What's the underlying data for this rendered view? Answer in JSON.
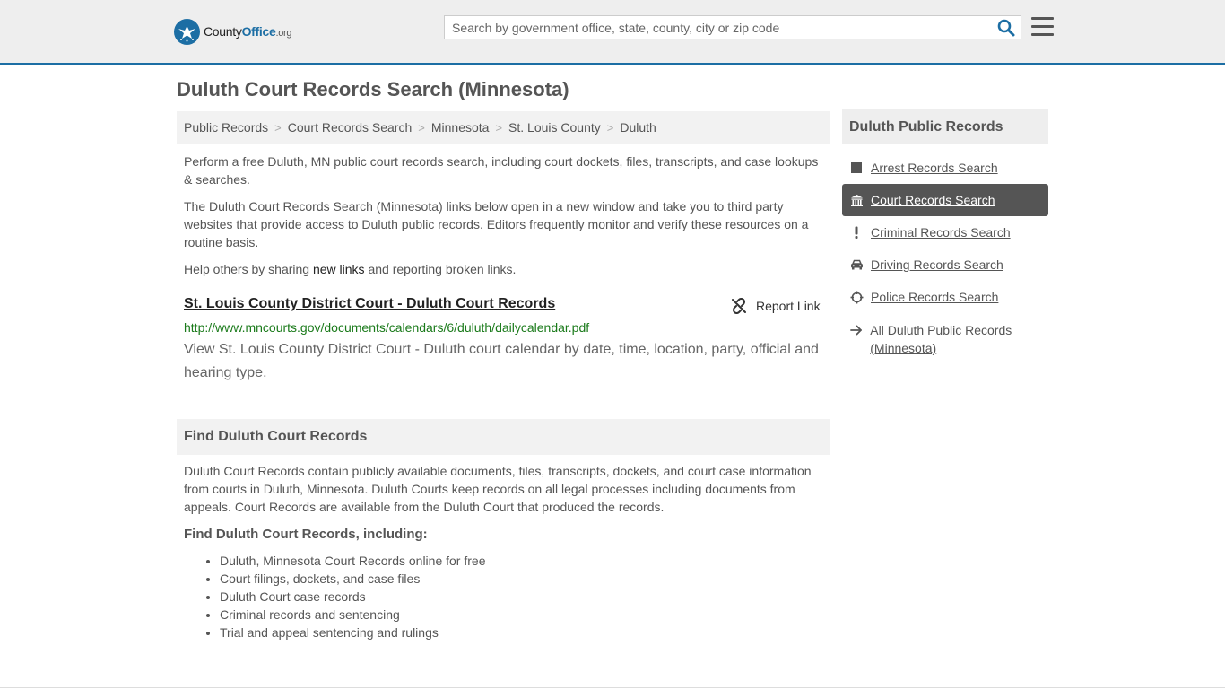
{
  "header": {
    "logo": {
      "brand_county": "County",
      "brand_office": "Office",
      "brand_org": ".org"
    },
    "search": {
      "placeholder": "Search by government office, state, county, city or zip code"
    }
  },
  "page": {
    "title": "Duluth Court Records Search (Minnesota)",
    "breadcrumb": [
      "Public Records",
      "Court Records Search",
      "Minnesota",
      "St. Louis County",
      "Duluth"
    ],
    "intro": {
      "p1": "Perform a free Duluth, MN public court records search, including court dockets, files, transcripts, and case lookups & searches.",
      "p2": "The Duluth Court Records Search (Minnesota) links below open in a new window and take you to third party websites that provide access to Duluth public records. Editors frequently monitor and verify these resources on a routine basis.",
      "p3_before": "Help others by sharing ",
      "p3_link": "new links",
      "p3_after": " and reporting broken links."
    },
    "result": {
      "title": "St. Louis County District Court - Duluth Court Records",
      "report_label": "Report Link",
      "url": "http://www.mncourts.gov/documents/calendars/6/duluth/dailycalendar.pdf",
      "description": "View St. Louis County District Court - Duluth court calendar by date, time, location, party, official and hearing type."
    },
    "find": {
      "heading": "Find Duluth Court Records",
      "text": "Duluth Court Records contain publicly available documents, files, transcripts, dockets, and court case information from courts in Duluth, Minnesota. Duluth Courts keep records on all legal processes including documents from appeals. Court Records are available from the Duluth Court that produced the records.",
      "subheading": "Find Duluth Court Records, including:",
      "items": [
        "Duluth, Minnesota Court Records online for free",
        "Court filings, dockets, and case files",
        "Duluth Court case records",
        "Criminal records and sentencing",
        "Trial and appeal sentencing and rulings"
      ]
    }
  },
  "sidebar": {
    "heading": "Duluth Public Records",
    "items": [
      {
        "label": "Arrest Records Search",
        "icon": "square-icon",
        "active": false
      },
      {
        "label": "Court Records Search",
        "icon": "courthouse-icon",
        "active": true
      },
      {
        "label": "Criminal Records Search",
        "icon": "exclamation-icon",
        "active": false
      },
      {
        "label": "Driving Records Search",
        "icon": "car-icon",
        "active": false
      },
      {
        "label": "Police Records Search",
        "icon": "crosshair-icon",
        "active": false
      },
      {
        "label": "All Duluth Public Records (Minnesota)",
        "icon": "arrow-right-icon",
        "active": false
      }
    ]
  },
  "colors": {
    "accent": "#1c6ea4",
    "active_bg": "#555555",
    "url_green": "#1a7a1a"
  }
}
